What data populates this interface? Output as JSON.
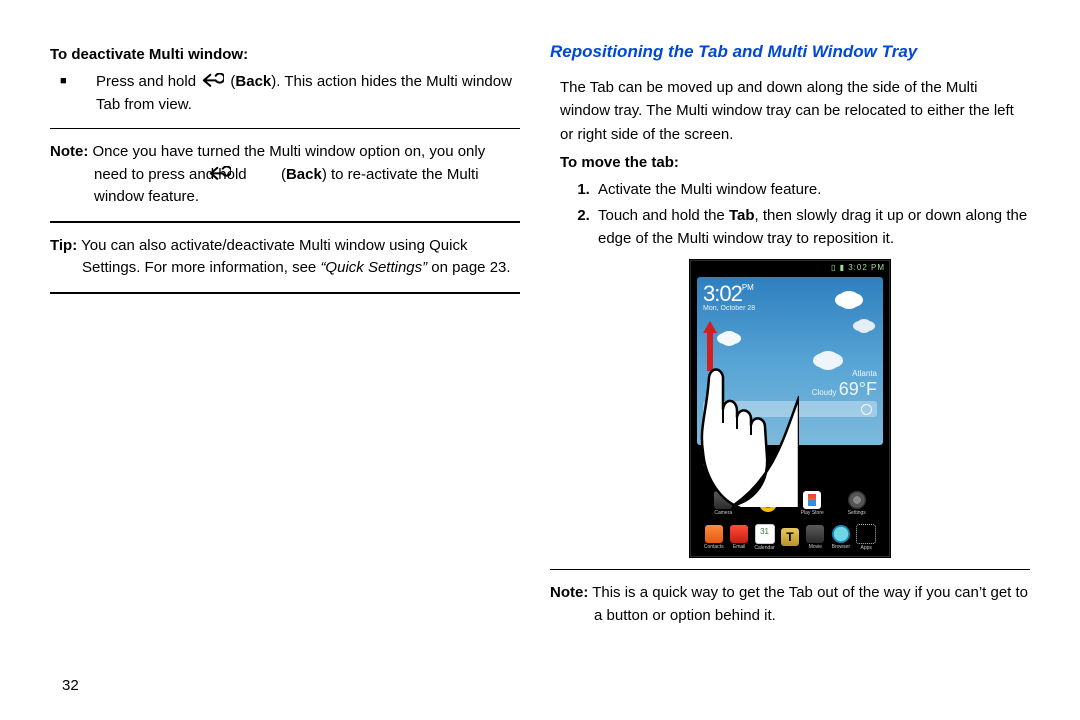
{
  "left": {
    "deactivate_heading": "To deactivate Multi window:",
    "bullet_pre": "Press and hold ",
    "bullet_bold": "Back",
    "bullet_post": ". This action hides the Multi window Tab from view.",
    "note_label": "Note:",
    "note_pre": " Once you have turned the Multi window option on, you only need to press and hold ",
    "note_bold": "Back",
    "note_post": " to re-activate the Multi window feature.",
    "tip_label": "Tip:",
    "tip_body": " You can also activate/deactivate Multi window using Quick Settings. For more information, see ",
    "tip_ital": "“Quick Settings”",
    "tip_tail": " on page 23."
  },
  "right": {
    "section_title": "Repositioning the Tab and Multi Window Tray",
    "intro": "The Tab can be moved up and down along the side of the Multi window tray. The Multi window tray can be relocated to either the left or right side of the screen.",
    "move_heading": "To move the tab:",
    "step1": "Activate the Multi window feature.",
    "step2_pre": "Touch and hold the ",
    "step2_bold": "Tab",
    "step2_post": ", then slowly drag it up or down along the edge of the Multi window tray to reposition it.",
    "note_label": "Note:",
    "note_body": " This is a quick way to get the Tab out of the way if you can’t get to a button or option behind it."
  },
  "figure": {
    "time": "3:02",
    "ampm": "PM",
    "date": "Mon, October 28",
    "status_time": "3:02 PM",
    "weather_city": "Atlanta",
    "weather_cond": "Cloudy",
    "weather_temp": "69°F",
    "dock1": [
      "Camera",
      " ",
      "Play Store",
      "Settings"
    ],
    "dock2": [
      "Contacts",
      "Email",
      "Calendar",
      "T",
      "Movie",
      "Browser",
      "Apps"
    ],
    "cal_day": "31"
  },
  "page_number": "32"
}
